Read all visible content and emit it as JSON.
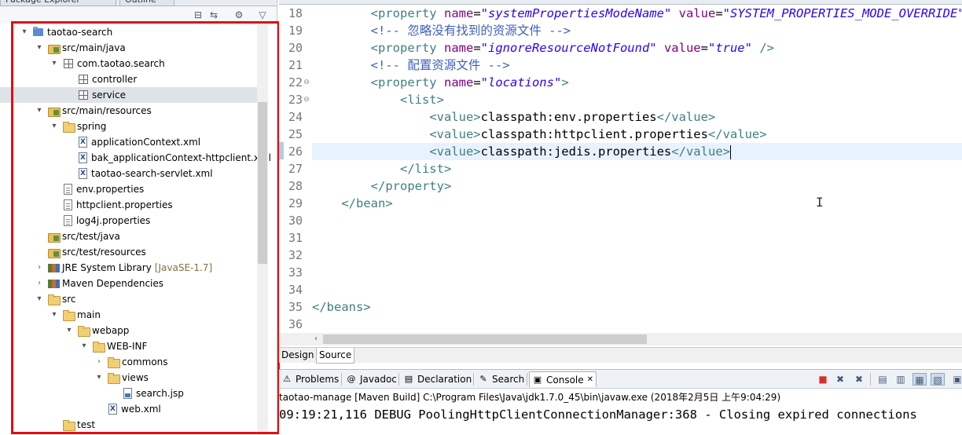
{
  "explorer": {
    "tab_title": "Package Explorer",
    "tab2_title": "Outline",
    "tree": [
      {
        "label": "taotao-search",
        "icon": "project-icon",
        "twist": "▾",
        "level": 0
      },
      {
        "label": "src/main/java",
        "icon": "source-folder-icon",
        "twist": "▾",
        "level": 1
      },
      {
        "label": "com.taotao.search",
        "icon": "package-icon",
        "twist": "▾",
        "level": 2
      },
      {
        "label": "controller",
        "icon": "package-icon",
        "twist": "",
        "level": 3
      },
      {
        "label": "service",
        "icon": "package-icon",
        "twist": "",
        "level": 3,
        "selected": true
      },
      {
        "label": "src/main/resources",
        "icon": "source-folder-icon",
        "twist": "▾",
        "level": 1
      },
      {
        "label": "spring",
        "icon": "folder-icon",
        "twist": "▾",
        "level": 2
      },
      {
        "label": "applicationContext.xml",
        "icon": "xml-file-icon",
        "twist": "",
        "level": 3
      },
      {
        "label": "bak_applicationContext-httpclient.xml",
        "icon": "xml-file-icon",
        "twist": "",
        "level": 3
      },
      {
        "label": "taotao-search-servlet.xml",
        "icon": "xml-file-icon",
        "twist": "",
        "level": 3
      },
      {
        "label": "env.properties",
        "icon": "properties-file-icon",
        "twist": "",
        "level": 2
      },
      {
        "label": "httpclient.properties",
        "icon": "properties-file-icon",
        "twist": "",
        "level": 2
      },
      {
        "label": "log4j.properties",
        "icon": "properties-file-icon",
        "twist": "",
        "level": 2
      },
      {
        "label": "src/test/java",
        "icon": "source-folder-icon",
        "twist": "",
        "level": 1
      },
      {
        "label": "src/test/resources",
        "icon": "source-folder-icon",
        "twist": "",
        "level": 1
      },
      {
        "label": "JRE System Library",
        "decoration": "[JavaSE-1.7]",
        "icon": "library-icon",
        "twist": "›",
        "level": 1
      },
      {
        "label": "Maven Dependencies",
        "icon": "library-icon",
        "twist": "›",
        "level": 1
      },
      {
        "label": "src",
        "icon": "folder-icon",
        "twist": "▾",
        "level": 1
      },
      {
        "label": "main",
        "icon": "folder-icon",
        "twist": "▾",
        "level": 2
      },
      {
        "label": "webapp",
        "icon": "folder-icon",
        "twist": "▾",
        "level": 3
      },
      {
        "label": "WEB-INF",
        "icon": "folder-icon",
        "twist": "▾",
        "level": 4
      },
      {
        "label": "commons",
        "icon": "folder-icon",
        "twist": "›",
        "level": 5
      },
      {
        "label": "views",
        "icon": "folder-icon",
        "twist": "▾",
        "level": 5
      },
      {
        "label": "search.jsp",
        "icon": "jsp-file-icon",
        "twist": "",
        "level": 6
      },
      {
        "label": "web.xml",
        "icon": "xml-file-icon",
        "twist": "",
        "level": 5
      },
      {
        "label": "test",
        "icon": "folder-icon",
        "twist": "",
        "level": 2
      }
    ]
  },
  "editor": {
    "first_line": 18,
    "current_line_index": 8,
    "lines": [
      [
        {
          "c": "t-txt",
          "t": "        "
        },
        {
          "c": "t-tag",
          "t": "<property "
        },
        {
          "c": "t-attr",
          "t": "name"
        },
        {
          "c": "t-txt",
          "t": "="
        },
        {
          "c": "t-val",
          "t": "\"systemPropertiesModeName\""
        },
        {
          "c": "t-txt",
          "t": " "
        },
        {
          "c": "t-attr",
          "t": "value"
        },
        {
          "c": "t-txt",
          "t": "="
        },
        {
          "c": "t-val",
          "t": "\"SYSTEM_PROPERTIES_MODE_OVERRIDE\""
        }
      ],
      [
        {
          "c": "t-txt",
          "t": "        "
        },
        {
          "c": "t-cmt",
          "t": "<!-- 忽略没有找到的资源文件 -->"
        }
      ],
      [
        {
          "c": "t-txt",
          "t": "        "
        },
        {
          "c": "t-tag",
          "t": "<property "
        },
        {
          "c": "t-attr",
          "t": "name"
        },
        {
          "c": "t-txt",
          "t": "="
        },
        {
          "c": "t-val",
          "t": "\"ignoreResourceNotFound\""
        },
        {
          "c": "t-txt",
          "t": " "
        },
        {
          "c": "t-attr",
          "t": "value"
        },
        {
          "c": "t-txt",
          "t": "="
        },
        {
          "c": "t-val",
          "t": "\"true\""
        },
        {
          "c": "t-txt",
          "t": " "
        },
        {
          "c": "t-tag",
          "t": "/>"
        }
      ],
      [
        {
          "c": "t-txt",
          "t": "        "
        },
        {
          "c": "t-cmt",
          "t": "<!-- 配置资源文件 -->"
        }
      ],
      [
        {
          "c": "t-txt",
          "t": "        "
        },
        {
          "c": "t-tag",
          "t": "<property "
        },
        {
          "c": "t-attr",
          "t": "name"
        },
        {
          "c": "t-txt",
          "t": "="
        },
        {
          "c": "t-val",
          "t": "\"locations\""
        },
        {
          "c": "t-tag",
          "t": ">"
        }
      ],
      [
        {
          "c": "t-txt",
          "t": "            "
        },
        {
          "c": "t-tag",
          "t": "<list>"
        }
      ],
      [
        {
          "c": "t-txt",
          "t": "                "
        },
        {
          "c": "t-tag",
          "t": "<value>"
        },
        {
          "c": "t-txt",
          "t": "classpath:env.properties"
        },
        {
          "c": "t-tag",
          "t": "</value>"
        }
      ],
      [
        {
          "c": "t-txt",
          "t": "                "
        },
        {
          "c": "t-tag",
          "t": "<value>"
        },
        {
          "c": "t-txt",
          "t": "classpath:httpclient.properties"
        },
        {
          "c": "t-tag",
          "t": "</value>"
        }
      ],
      [
        {
          "c": "t-txt",
          "t": "                "
        },
        {
          "c": "t-tag",
          "t": "<value>"
        },
        {
          "c": "t-txt",
          "t": "classpath:jedis.properties"
        },
        {
          "c": "t-tag",
          "t": "</value>"
        }
      ],
      [
        {
          "c": "t-txt",
          "t": "            "
        },
        {
          "c": "t-tag",
          "t": "</list>"
        }
      ],
      [
        {
          "c": "t-txt",
          "t": "        "
        },
        {
          "c": "t-tag",
          "t": "</property>"
        }
      ],
      [
        {
          "c": "t-txt",
          "t": "    "
        },
        {
          "c": "t-tag",
          "t": "</bean>"
        }
      ],
      [],
      [],
      [],
      [],
      [],
      [
        {
          "c": "t-tag",
          "t": "</beans>"
        }
      ],
      []
    ],
    "fold_lines": [
      22,
      23
    ],
    "fold_glyph": "⊖"
  },
  "editor_tabs": {
    "design": "Design",
    "source": "Source"
  },
  "console": {
    "tabs": [
      {
        "label": "Problems",
        "icon": "problems-icon",
        "glyph": "⚠"
      },
      {
        "label": "Javadoc",
        "icon": "javadoc-icon",
        "glyph": "@"
      },
      {
        "label": "Declaration",
        "icon": "declaration-icon",
        "glyph": "▤"
      },
      {
        "label": "Search",
        "icon": "search-icon",
        "glyph": "✎"
      },
      {
        "label": "Console",
        "icon": "console-icon",
        "glyph": "▣",
        "active": true
      }
    ],
    "close_glyph": "✕",
    "description": "taotao-manage [Maven Build] C:\\Program Files\\Java\\jdk1.7.0_45\\bin\\javaw.exe (2018年2月5日 上午9:04:29)",
    "output": "09:19:21,116 DEBUG PoolingHttpClientConnectionManager:368 - Closing expired connections",
    "colors": {
      "terminate": "#d9302c",
      "highlight": "#e01010"
    }
  }
}
